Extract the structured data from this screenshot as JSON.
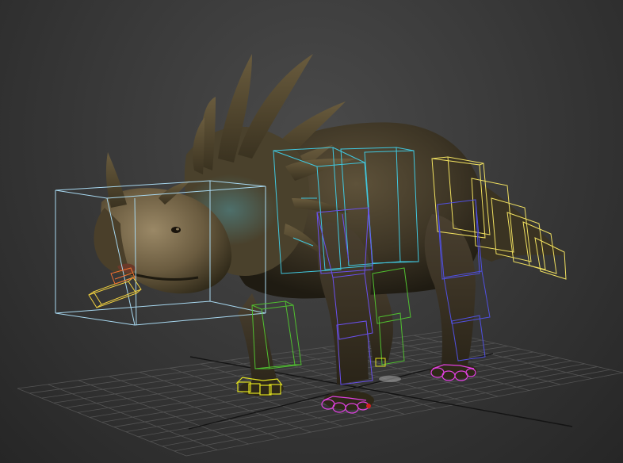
{
  "viewport": {
    "background_top": "#4a4a4a",
    "background_bottom": "#262626"
  },
  "colors": {
    "grid": "#5c5c5c",
    "grid_axis": "#141414",
    "head_bone": "#a8d8f0",
    "neck_bone": "#5ac8e0",
    "spine_bone": "#40c8e0",
    "tail_bone": "#f0e060",
    "jaw_bone": "#f0d040",
    "tongue_bone": "#f07030",
    "front_right_leg": "#50c030",
    "front_left_leg": "#6a50f0",
    "hind_leg": "#5050e0",
    "front_right_foot": "#e0e020",
    "front_left_foot": "#e040e0",
    "hind_foot": "#e040e0",
    "skin_dark": "#3a3322",
    "skin_mid": "#5a4e36",
    "skin_light": "#8a7a5a",
    "horn": "#4a3f28",
    "frill_tint": "#3f6060"
  },
  "scene": {
    "object": "triceratops-rig",
    "rig_parts": [
      "head",
      "jaw",
      "neck",
      "spine",
      "tail",
      "front-right-leg",
      "front-left-leg",
      "hind-left-leg",
      "hind-right-leg",
      "feet"
    ]
  }
}
